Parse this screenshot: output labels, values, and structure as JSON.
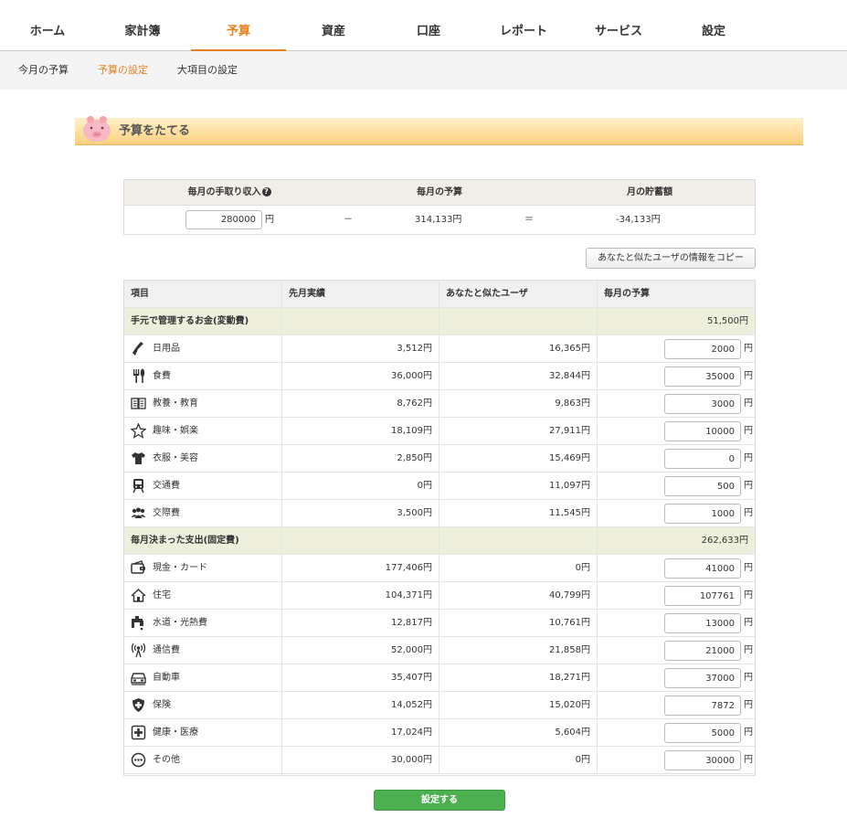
{
  "nav": [
    "ホーム",
    "家計簿",
    "予算",
    "資産",
    "口座",
    "レポート",
    "サービス",
    "設定"
  ],
  "subnav": [
    "今月の予算",
    "予算の設定",
    "大項目の設定"
  ],
  "banner": {
    "title": "予算をたてる"
  },
  "summary": {
    "income_label": "毎月の手取り収入",
    "budget_label": "毎月の予算",
    "savings_label": "月の貯蓄額",
    "income_value": "280000",
    "yen": "円",
    "minus": "－",
    "equals": "＝",
    "budget_value": "314,133円",
    "savings_value": "-34,133円",
    "help_icon": "question-circle-icon"
  },
  "copy_button": "あなたと似たユーザの情報をコピー",
  "table": {
    "headers": [
      "項目",
      "先月実績",
      "あなたと似たユーザ",
      "毎月の予算"
    ],
    "yen": "円",
    "variable": {
      "label": "手元で管理するお金(変動費)",
      "total": "51,500円",
      "rows": [
        {
          "label": "日用品",
          "last": "3,512円",
          "similar": "16,365円",
          "budget": "2000",
          "icon": "broom-icon"
        },
        {
          "label": "食費",
          "last": "36,000円",
          "similar": "32,844円",
          "budget": "35000",
          "icon": "fork-knife-icon"
        },
        {
          "label": "教養・教育",
          "last": "8,762円",
          "similar": "9,863円",
          "budget": "3000",
          "icon": "book-icon"
        },
        {
          "label": "趣味・娯楽",
          "last": "18,109円",
          "similar": "27,911円",
          "budget": "10000",
          "icon": "star-icon"
        },
        {
          "label": "衣服・美容",
          "last": "2,850円",
          "similar": "15,469円",
          "budget": "0",
          "icon": "shirt-icon"
        },
        {
          "label": "交通費",
          "last": "0円",
          "similar": "11,097円",
          "budget": "500",
          "icon": "train-icon"
        },
        {
          "label": "交際費",
          "last": "3,500円",
          "similar": "11,545円",
          "budget": "1000",
          "icon": "people-icon"
        }
      ]
    },
    "fixed": {
      "label": "毎月決まった支出(固定費)",
      "total": "262,633円",
      "rows": [
        {
          "label": "現金・カード",
          "last": "177,406円",
          "similar": "0円",
          "budget": "41000",
          "icon": "wallet-icon"
        },
        {
          "label": "住宅",
          "last": "104,371円",
          "similar": "40,799円",
          "budget": "107761",
          "icon": "house-icon"
        },
        {
          "label": "水道・光熱費",
          "last": "12,817円",
          "similar": "10,761円",
          "budget": "13000",
          "icon": "faucet-icon"
        },
        {
          "label": "通信費",
          "last": "52,000円",
          "similar": "21,858円",
          "budget": "21000",
          "icon": "antenna-icon"
        },
        {
          "label": "自動車",
          "last": "35,407円",
          "similar": "18,271円",
          "budget": "37000",
          "icon": "car-icon"
        },
        {
          "label": "保険",
          "last": "14,052円",
          "similar": "15,020円",
          "budget": "7872",
          "icon": "shield-plus-icon"
        },
        {
          "label": "健康・医療",
          "last": "17,024円",
          "similar": "5,604円",
          "budget": "5000",
          "icon": "medical-cross-icon"
        },
        {
          "label": "その他",
          "last": "30,000円",
          "similar": "0円",
          "budget": "30000",
          "icon": "dots-circle-icon"
        }
      ]
    }
  },
  "submit_button": "設定する",
  "colors": {
    "accent": "#e8801e",
    "button_green": "#4caf50",
    "category_bg": "#eeeedc"
  }
}
